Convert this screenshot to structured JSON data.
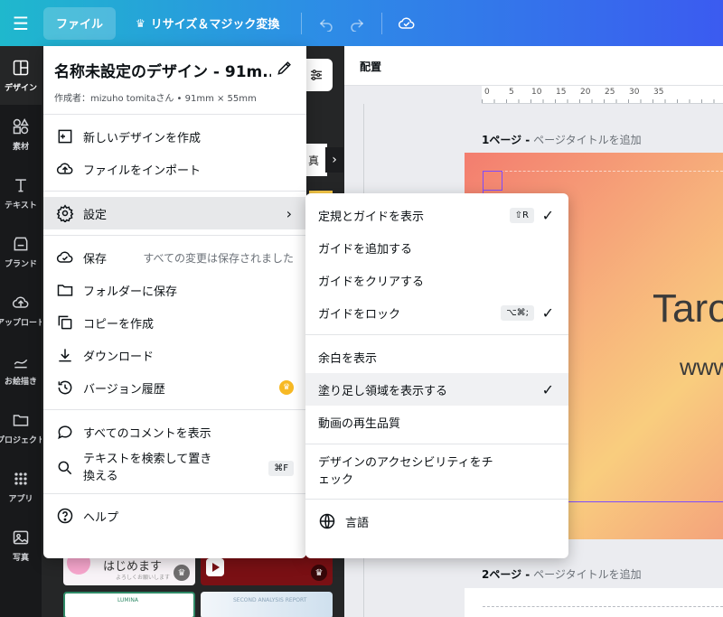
{
  "topbar": {
    "menu_icon": "hamburger-icon",
    "file_label": "ファイル",
    "resize_label": "リサイズ＆マジック変換",
    "undo_icon": "undo-icon",
    "redo_icon": "redo-icon",
    "cloud_icon": "cloud-check-icon"
  },
  "rail": {
    "items": [
      {
        "label": "デザイン",
        "icon": "design-icon"
      },
      {
        "label": "素材",
        "icon": "elements-icon"
      },
      {
        "label": "テキスト",
        "icon": "text-icon"
      },
      {
        "label": "ブランド",
        "icon": "brand-icon"
      },
      {
        "label": "アップロード",
        "icon": "upload-icon"
      },
      {
        "label": "お絵描き",
        "icon": "draw-icon"
      },
      {
        "label": "プロジェクト",
        "icon": "folder-icon"
      },
      {
        "label": "アプリ",
        "icon": "apps-icon"
      },
      {
        "label": "写真",
        "icon": "photo-icon"
      }
    ]
  },
  "sidepanel": {
    "chip_label": "真",
    "thumb1_title": "はじめます",
    "thumb1_sub": "よろしくお願いします",
    "thumb3_text": "LUMINA",
    "thumb4_text": "SECOND ANALYSIS REPORT"
  },
  "canvas": {
    "header_label": "配置",
    "ruler_marks": [
      "0",
      "5",
      "10",
      "15",
      "20",
      "25",
      "30",
      "35"
    ],
    "ruler_left_mark": "0",
    "page1_label": "1ページ -",
    "page1_placeholder": "ページタイトルを追加",
    "page2_label": "2ページ -",
    "page2_placeholder": "ページタイトルを追加",
    "page1_big_text": "Taro",
    "page1_small_text": "www"
  },
  "menu": {
    "title": "名称未設定のデザイン - 91m...",
    "author": "作成者：mizuho tomitaさん • 91mm × 55mm",
    "items": {
      "new_design": "新しいデザインを作成",
      "import": "ファイルをインポート",
      "settings": "設定",
      "save": "保存",
      "save_status": "すべての変更は保存されました",
      "save_folder": "フォルダーに保存",
      "copy": "コピーを作成",
      "download": "ダウンロード",
      "version": "バージョン履歴",
      "comments": "すべてのコメントを表示",
      "find_replace": "テキストを検索して置き換える",
      "find_replace_kbd": "⌘F",
      "help": "ヘルプ"
    }
  },
  "submenu": {
    "items": {
      "rulers": "定規とガイドを表示",
      "rulers_kbd": "⇧R",
      "add_guide": "ガイドを追加する",
      "clear_guide": "ガイドをクリアする",
      "lock_guide": "ガイドをロック",
      "lock_guide_kbd": "⌥⌘;",
      "margins": "余白を表示",
      "bleed": "塗り足し領域を表示する",
      "video_quality": "動画の再生品質",
      "accessibility": "デザインのアクセシビリティをチェック",
      "language": "言語"
    },
    "checked": {
      "rulers": true,
      "lock_guide": true,
      "bleed": true
    }
  },
  "colors": {
    "topbar_start": "#1fb8cd",
    "topbar_end": "#3b5bf0",
    "rail_bg": "#18191b",
    "guide_color": "#7c4dff",
    "pro_badge": "#f7b924"
  }
}
